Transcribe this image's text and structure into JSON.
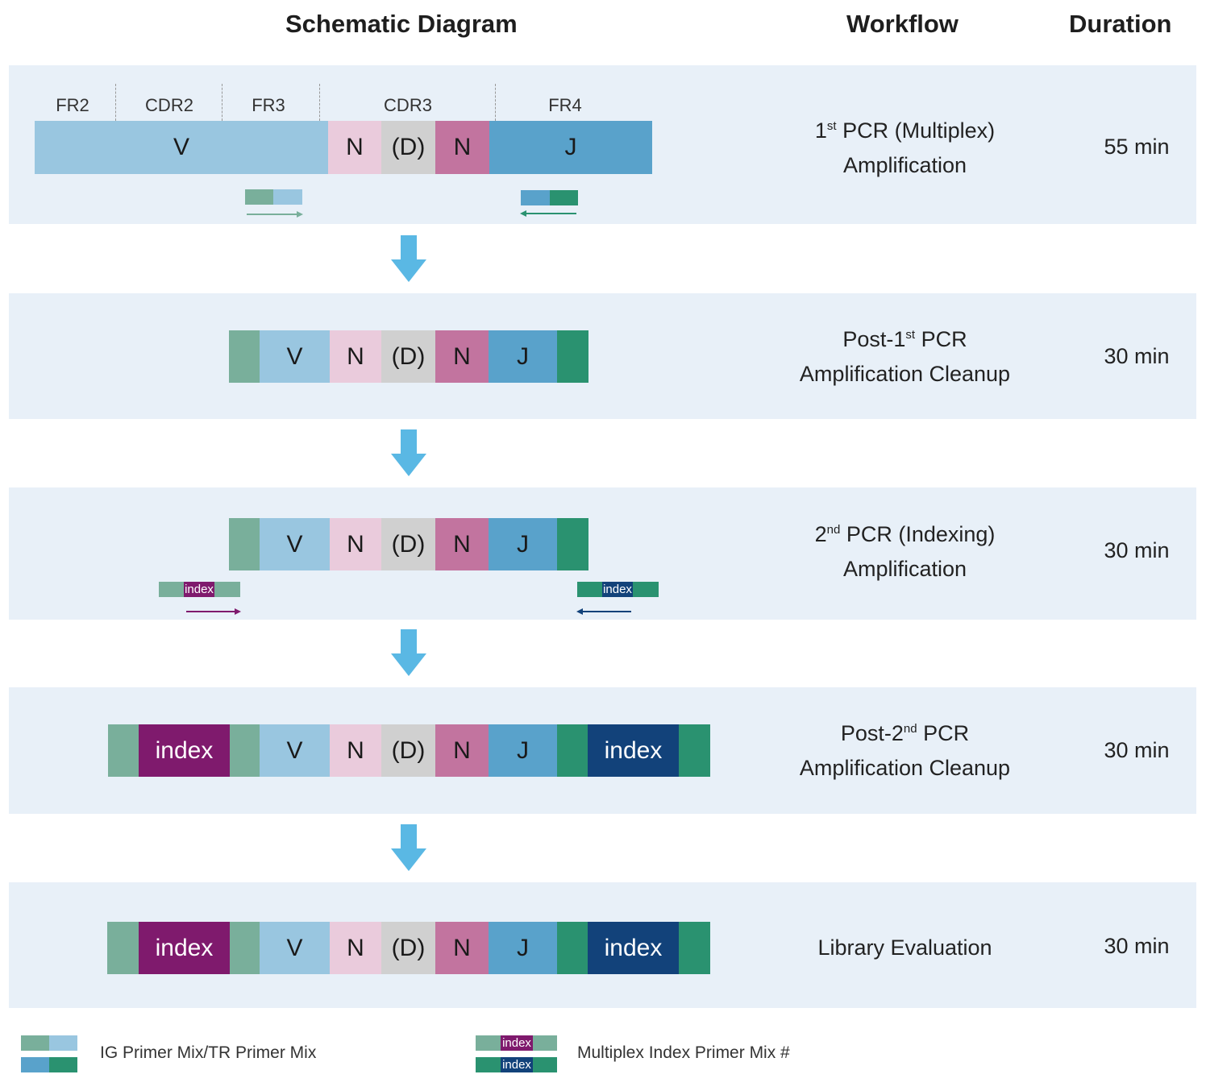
{
  "headers": {
    "schematic": "Schematic Diagram",
    "workflow": "Workflow",
    "duration": "Duration"
  },
  "colors": {
    "panel_bg": "#e8f0f8",
    "V": "#99c6e0",
    "N_light": "#eacbdc",
    "D": "#d0d0d0",
    "N_dark": "#c2749f",
    "J": "#59a2cb",
    "primer_teal": "#79af9b",
    "primer_green": "#2a9270",
    "index_purple": "#7f1a6d",
    "index_navy": "#12427a",
    "arrow_blue": "#5ab8e4"
  },
  "regions": [
    "FR2",
    "CDR2",
    "FR3",
    "CDR3",
    "FR4"
  ],
  "segment_labels": {
    "V": "V",
    "N": "N",
    "D": "(D)",
    "J": "J",
    "index": "index"
  },
  "steps": [
    {
      "workflow_pre": "1",
      "workflow_sup": "st",
      "workflow_post": " PCR (Multiplex)",
      "workflow_line2": "Amplification",
      "duration": "55 min"
    },
    {
      "workflow_pre": "Post-1",
      "workflow_sup": "st",
      "workflow_post": " PCR",
      "workflow_line2": "Amplification Cleanup",
      "duration": "30 min"
    },
    {
      "workflow_pre": "2",
      "workflow_sup": "nd",
      "workflow_post": " PCR (Indexing)",
      "workflow_line2": "Amplification",
      "duration": "30 min"
    },
    {
      "workflow_pre": "Post-2",
      "workflow_sup": "nd",
      "workflow_post": " PCR",
      "workflow_line2": "Amplification Cleanup",
      "duration": "30 min"
    },
    {
      "workflow_line1": "Library Evaluation",
      "duration": "30 min"
    }
  ],
  "legend": {
    "primer_mix": "IG Primer Mix/TR Primer Mix",
    "index_mix": "Multiplex Index Primer Mix #",
    "index_label": "index"
  }
}
